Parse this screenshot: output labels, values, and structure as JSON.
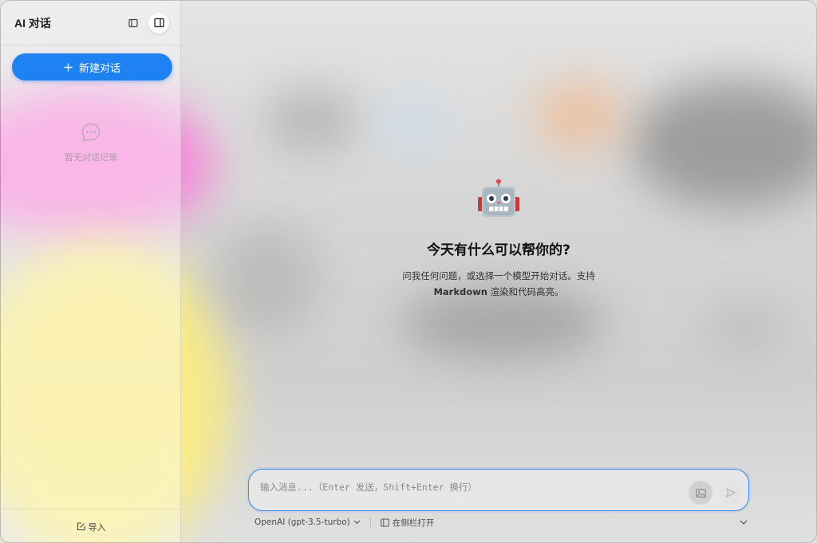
{
  "sidebar": {
    "title": "AI 对话",
    "new_chat_label": "新建对话",
    "empty_text": "暂无对话记录",
    "import_label": "导入"
  },
  "main": {
    "welcome_emoji": "🤖",
    "welcome_title": "今天有什么可以帮你的?",
    "welcome_sub_line1": "问我任何问题，或选择一个模型开始对话。支持",
    "welcome_sub_bold": "Markdown",
    "welcome_sub_line2": " 渲染和代码高亮。"
  },
  "composer": {
    "placeholder": "输入消息...（Enter 发送，Shift+Enter 换行）",
    "value": ""
  },
  "bottom_bar": {
    "model_label": "OpenAI (gpt-3.5-turbo)",
    "open_sidebar_label": "在侧栏打开"
  },
  "colors": {
    "accent": "#1e82f2",
    "input_border": "#3b8ef0"
  },
  "icons": {
    "collapse": "panel-left-icon",
    "sidebar_toggle": "sidebar-icon",
    "plus": "plus-icon",
    "empty": "chat-bubble-icon",
    "import": "import-icon",
    "image": "image-icon",
    "send": "send-icon",
    "chevron": "chevron-down-icon"
  }
}
